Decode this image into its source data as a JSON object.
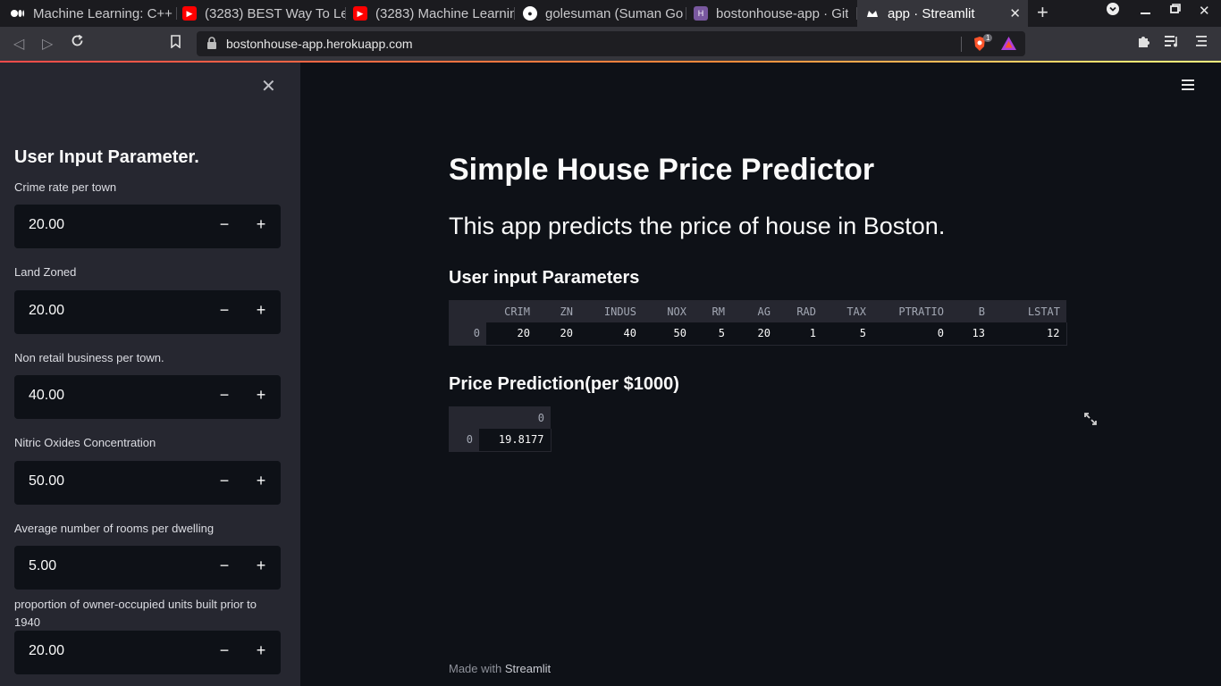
{
  "browser": {
    "tabs": [
      {
        "label": "Machine Learning: C++",
        "icon": "medium-icon"
      },
      {
        "label": "(3283) BEST Way To Le",
        "icon": "youtube-icon"
      },
      {
        "label": "(3283) Machine Learnin",
        "icon": "youtube-icon"
      },
      {
        "label": "golesuman (Suman Go",
        "icon": "github-icon"
      },
      {
        "label": "bostonhouse-app · Git",
        "icon": "heroku-icon"
      },
      {
        "label": "app · Streamlit",
        "icon": "streamlit-icon",
        "active": true
      }
    ],
    "url": "bostonhouse-app.herokuapp.com",
    "brave_badge": "1"
  },
  "sidebar": {
    "header": "User Input Parameter.",
    "fields": [
      {
        "label": "Crime rate per town",
        "value": "20.00"
      },
      {
        "label": "Land Zoned",
        "value": "20.00"
      },
      {
        "label": "Non retail business per town.",
        "value": "40.00"
      },
      {
        "label": "Nitric Oxides Concentration",
        "value": "50.00"
      },
      {
        "label": "Average number of rooms per dwelling",
        "value": "5.00"
      },
      {
        "label": "proportion of owner-occupied units built prior to 1940",
        "value": "20.00"
      }
    ],
    "minus": "−",
    "plus": "+"
  },
  "main": {
    "title": "Simple House Price Predictor",
    "subtitle": "This app predicts the price of house in Boston.",
    "params_heading": "User input Parameters",
    "params_table": {
      "columns": [
        "CRIM",
        "ZN",
        "INDUS",
        "NOX",
        "RM",
        "AG",
        "RAD",
        "TAX",
        "PTRATIO",
        "B",
        "LSTAT"
      ],
      "rows": [
        {
          "index": "0",
          "values": [
            "20",
            "20",
            "40",
            "50",
            "5",
            "20",
            "1",
            "5",
            "0",
            "13",
            "12"
          ]
        }
      ]
    },
    "prediction_heading": "Price Prediction(per $1000)",
    "prediction_table": {
      "columns": [
        "0"
      ],
      "rows": [
        {
          "index": "0",
          "values": [
            "19.8177"
          ]
        }
      ]
    },
    "footer_prefix": "Made with ",
    "footer_brand": "Streamlit"
  },
  "colors": {
    "sidebar_bg": "#262730",
    "main_bg": "#0e1117",
    "accent": "#ff4b4b"
  }
}
